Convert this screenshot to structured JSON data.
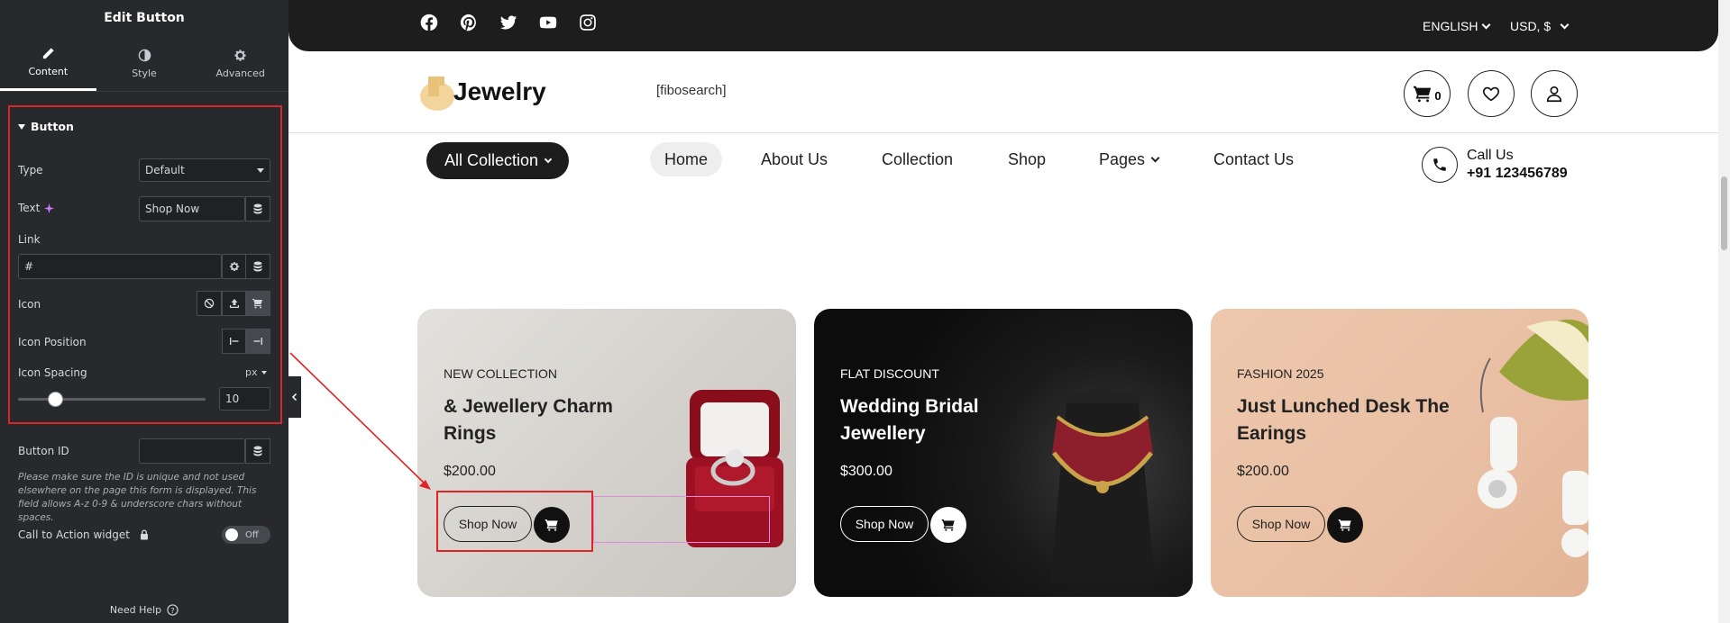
{
  "panel": {
    "title": "Edit Button",
    "tabs": [
      {
        "label": "Content",
        "icon": "pencil-icon",
        "active": true
      },
      {
        "label": "Style",
        "icon": "contrast-icon",
        "active": false
      },
      {
        "label": "Advanced",
        "icon": "gear-icon",
        "active": false
      }
    ],
    "section": "Button",
    "type": {
      "label": "Type",
      "value": "Default"
    },
    "text": {
      "label": "Text",
      "value": "Shop Now"
    },
    "link": {
      "label": "Link",
      "value": "#"
    },
    "icon": {
      "label": "Icon",
      "options": [
        "none-icon",
        "upload-icon",
        "cart-icon"
      ],
      "selected": "cart-icon"
    },
    "icon_position": {
      "label": "Icon Position",
      "selected": "after"
    },
    "icon_spacing": {
      "label": "Icon Spacing",
      "unit": "px",
      "value": "10",
      "level": 0.2
    },
    "button_id": {
      "label": "Button ID",
      "value": ""
    },
    "note": "Please make sure the ID is unique and not used elsewhere on the page this form is displayed. This field allows A-z  0-9 & underscore chars without spaces.",
    "cta": {
      "label": "Call to Action widget",
      "toggle": "Off"
    },
    "help": "Need Help"
  },
  "site": {
    "social_icons": [
      "facebook-icon",
      "pinterest-icon",
      "twitter-icon",
      "youtube-icon",
      "instagram-icon"
    ],
    "language": "ENGLISH",
    "currency": "USD, $",
    "logo": "Jewelry",
    "search": "[fibosearch]",
    "cart_count": "0",
    "all_collection": "All Collection",
    "nav": [
      "Home",
      "About Us",
      "Collection",
      "Shop",
      "Pages",
      "Contact Us"
    ],
    "call_label": "Call Us",
    "call_number": "+91 123456789",
    "cards": [
      {
        "tag": "NEW COLLECTION",
        "title": "& Jewellery Charm Rings",
        "price": "$200.00",
        "button": "Shop Now"
      },
      {
        "tag": "FLAT DISCOUNT",
        "title": "Wedding Bridal Jewellery",
        "price": "$300.00",
        "button": "Shop Now"
      },
      {
        "tag": "FASHION 2025",
        "title": "Just Lunched Desk The Earings",
        "price": "$200.00",
        "button": "Shop Now"
      }
    ]
  },
  "colors": {
    "panel_bg": "#27292c",
    "topbar": "#1d1d1d",
    "selection_red": "#e02424",
    "card1": "#d9d6d1",
    "card2": "#0f0f0f",
    "card3": "#e9c1a5"
  }
}
